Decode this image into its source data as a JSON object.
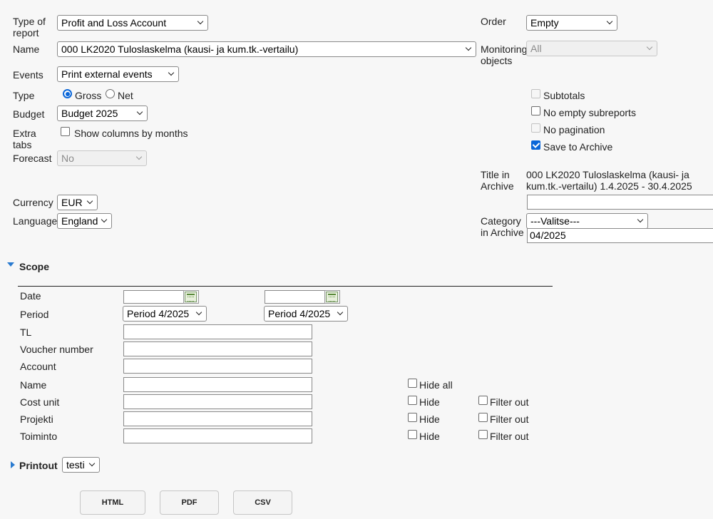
{
  "report": {
    "type_label": "Type of report",
    "type_value": "Profit and Loss Account",
    "name_label": "Name",
    "name_value": "000 LK2020 Tuloslaskelma (kausi- ja kum.tk.-vertailu)",
    "events_label": "Events",
    "events_value": "Print external events",
    "kind_label": "Type",
    "gross_label": "Gross",
    "net_label": "Net",
    "kind_selected": "Gross",
    "budget_label": "Budget",
    "budget_value": "Budget 2025",
    "extra_tabs_label": "Extra tabs",
    "show_columns_label": "Show columns by months",
    "forecast_label": "Forecast",
    "forecast_value": "No",
    "currency_label": "Currency",
    "currency_value": "EUR",
    "language_label": "Language",
    "language_value": "England"
  },
  "right": {
    "order_label": "Order",
    "order_value": "Empty",
    "monitoring_label": "Monitoring objects",
    "monitoring_value": "All",
    "subtotals_label": "Subtotals",
    "no_empty_label": "No empty subreports",
    "no_pagination_label": "No pagination",
    "save_archive_label": "Save to Archive",
    "save_archive_checked": true,
    "title_archive_label": "Title in Archive",
    "title_archive_value": "000 LK2020 Tuloslaskelma (kausi- ja kum.tk.-vertailu) 1.4.2025 - 30.4.2025",
    "title_input_value": "",
    "category_label": "Category in Archive",
    "category_value": "---Valitse---",
    "category_input_value": "04/2025"
  },
  "scope": {
    "heading": "Scope",
    "date_label": "Date",
    "date_from": "",
    "date_to": "",
    "period_label": "Period",
    "period_from": "Period 4/2025",
    "period_to": "Period 4/2025",
    "tl_label": "TL",
    "voucher_label": "Voucher number",
    "account_label": "Account",
    "name_label": "Name",
    "hide_all_label": "Hide all",
    "rows": [
      {
        "label": "Cost unit",
        "hide": "Hide",
        "filter": "Filter out"
      },
      {
        "label": "Projekti",
        "hide": "Hide",
        "filter": "Filter out"
      },
      {
        "label": "Toiminto",
        "hide": "Hide",
        "filter": "Filter out"
      }
    ]
  },
  "printout": {
    "heading": "Printout",
    "value": "testi"
  },
  "buttons": {
    "html": "HTML",
    "pdf": "PDF",
    "csv": "CSV"
  }
}
